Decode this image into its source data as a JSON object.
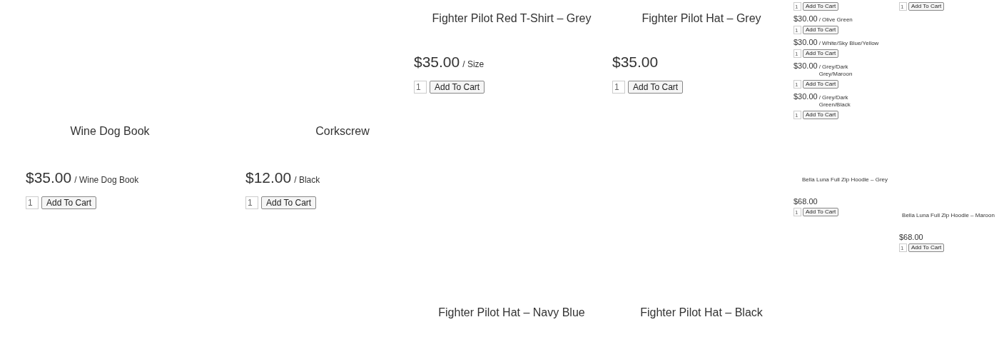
{
  "columns": [
    {
      "products": [
        {
          "title": "Wine Dog Book",
          "offers": [
            {
              "price": "$35.00",
              "variant": "/ Wine Dog Book",
              "quantity": "1",
              "button": "Add To Cart"
            }
          ]
        }
      ]
    },
    {
      "products": [
        {
          "title": "Corkscrew",
          "offers": [
            {
              "price": "$12.00",
              "variant": "/ Black",
              "quantity": "1",
              "button": "Add To Cart"
            }
          ]
        }
      ]
    },
    {
      "products": [
        {
          "title": "Fighter Pilot Red T-Shirt – Grey",
          "offers": [
            {
              "price": "$35.00",
              "variant": "/ Size",
              "quantity": "1",
              "button": "Add To Cart"
            }
          ]
        },
        {
          "title": "Fighter Pilot Hat – Navy Blue"
        }
      ]
    },
    {
      "products": [
        {
          "title": "Fighter Pilot Hat – Grey",
          "offers": [
            {
              "price": "$35.00",
              "quantity": "1",
              "button": "Add To Cart"
            }
          ]
        },
        {
          "title": "Fighter Pilot Hat – Black"
        }
      ]
    },
    {
      "products": [
        {
          "offers": [
            {
              "quantity": "1",
              "button": "Add To Cart"
            },
            {
              "price": "$30.00",
              "variant": "/ Olive Green",
              "quantity": "1",
              "button": "Add To Cart"
            },
            {
              "price": "$30.00",
              "variant": "/ White/Sky Blue/Yellow",
              "quantity": "1",
              "button": "Add To Cart"
            },
            {
              "price": "$30.00",
              "variant": "/ Grey/Dark Grey/Maroon",
              "quantity": "1",
              "button": "Add To Cart"
            },
            {
              "price": "$30.00",
              "variant": "/ Grey/Dark Green/Black",
              "quantity": "1",
              "button": "Add To Cart"
            }
          ]
        },
        {
          "title": "Bella Luna Full Zip Hoodie – Grey",
          "offers": [
            {
              "price": "$68.00",
              "quantity": "1",
              "button": "Add To Cart"
            }
          ]
        }
      ]
    },
    {
      "products": [
        {
          "offers": [
            {
              "quantity": "1",
              "button": "Add To Cart"
            }
          ]
        },
        {
          "title": "Bella Luna Full Zip Hoodie – Maroon",
          "offers": [
            {
              "price": "$68.00",
              "quantity": "1",
              "button": "Add To Cart"
            }
          ]
        }
      ]
    }
  ]
}
